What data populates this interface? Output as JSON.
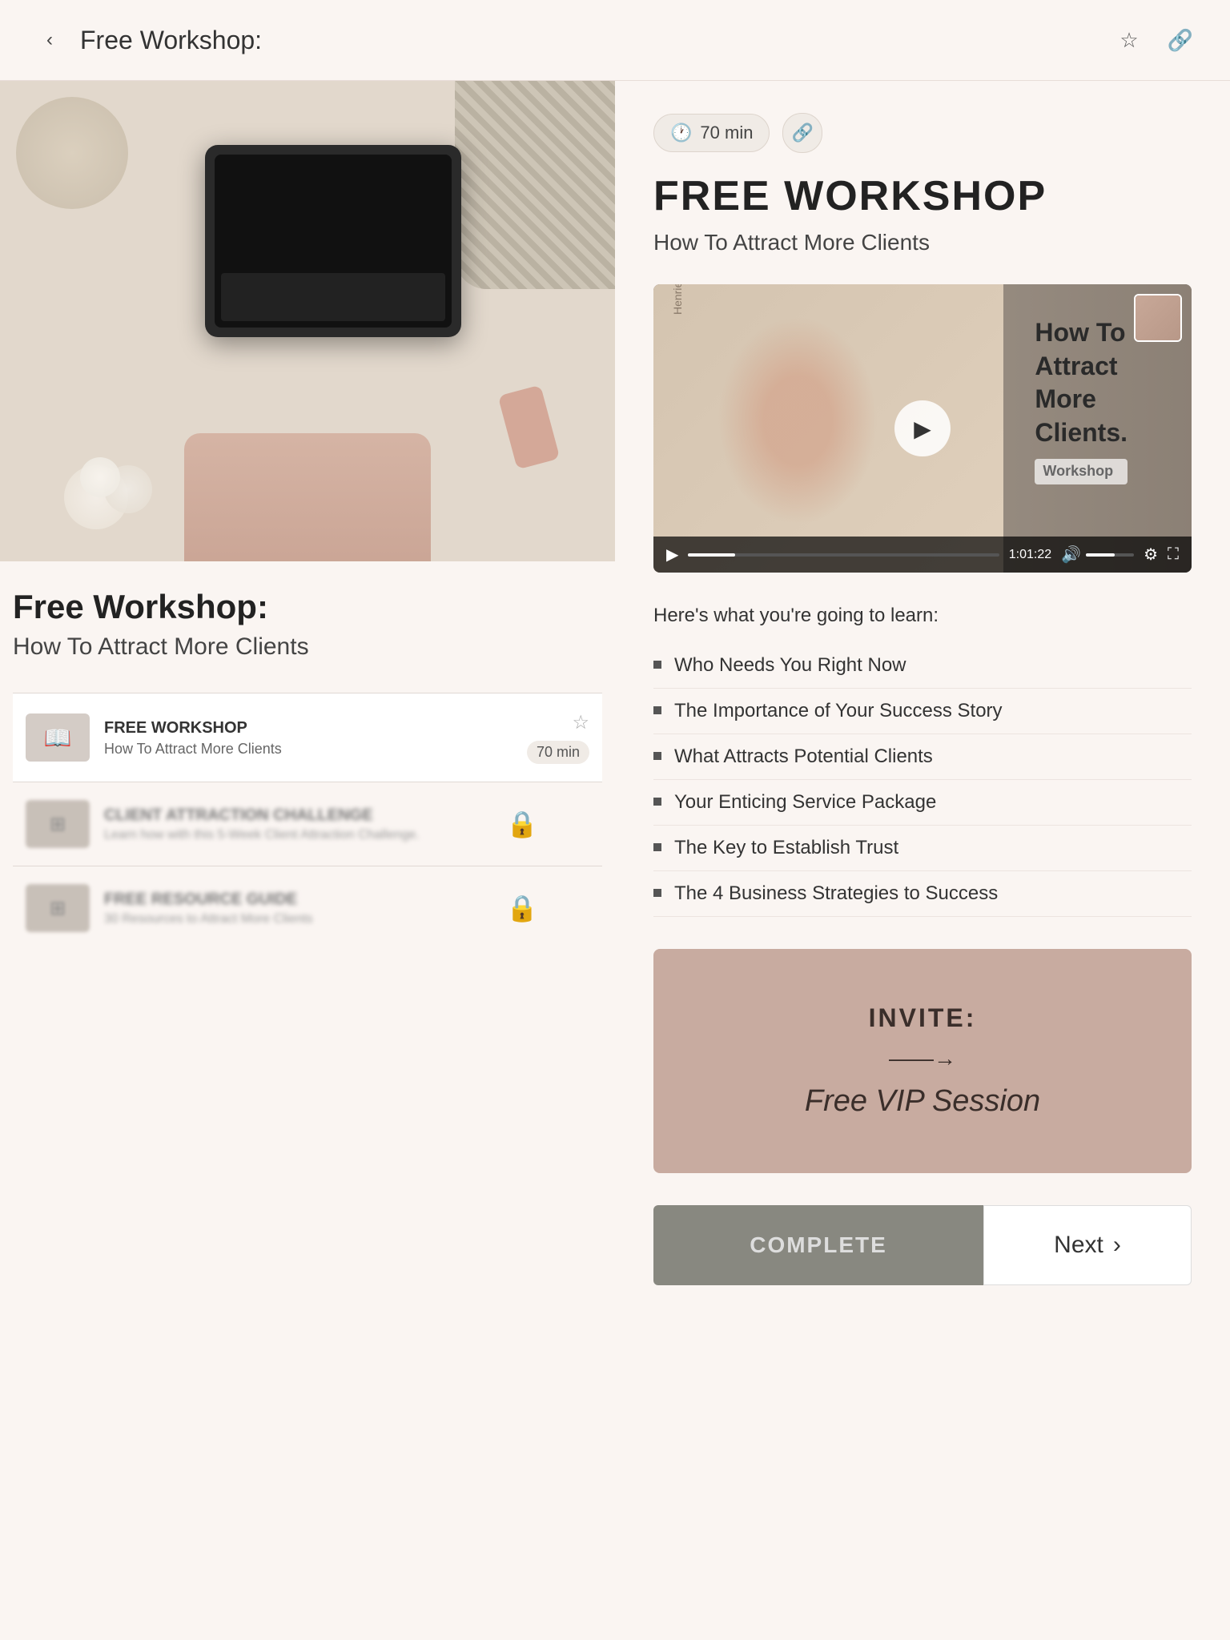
{
  "header": {
    "title": "Free Workshop:",
    "back_label": "‹",
    "bookmark_icon": "☆",
    "share_icon": "🔗"
  },
  "hero": {
    "alt": "Laptop on desk top-down view"
  },
  "left_section": {
    "title": "Free Workshop:",
    "subtitle": "How To Attract More Clients",
    "course_list": [
      {
        "name": "FREE WORKSHOP",
        "sub": "How To Attract More Clients",
        "duration": "70 min",
        "locked": false,
        "active": true,
        "thumb_icon": "📖"
      },
      {
        "name": "CLIENT ATTRACTION CHALLENGE",
        "sub": "Learn how with this 5-Week Client Attraction Challenge.",
        "duration": "",
        "locked": true,
        "active": false,
        "thumb_icon": "⊞"
      },
      {
        "name": "FREE RESOURCE GUIDE",
        "sub": "30 Resources to Attract More Clients",
        "duration": "",
        "locked": true,
        "active": false,
        "thumb_icon": "⊞"
      }
    ]
  },
  "right_section": {
    "duration": "70 min",
    "duration_icon": "🕐",
    "title": "FREE WORKSHOP",
    "subtitle": "How To Attract More Clients",
    "video": {
      "time": "1:01:22",
      "play_icon": "▶"
    },
    "learn_intro": "Here's what you're going to learn:",
    "learn_items": [
      "Who Needs You Right Now",
      "The Importance of Your Success Story",
      "What Attracts Potential Clients",
      "Your Enticing Service Package",
      "The Key to Establish Trust",
      "The 4 Business Strategies to Success"
    ],
    "invite": {
      "label": "INVITE:",
      "arrow": "——→",
      "title": "Free VIP Session"
    },
    "complete_label": "COMPLETE",
    "next_label": "Next"
  }
}
